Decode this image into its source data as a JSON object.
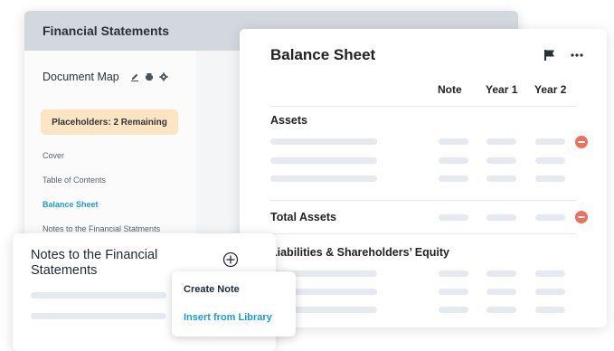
{
  "financial_statements": {
    "title": "Financial Statements",
    "document_map": {
      "label": "Document Map",
      "icons": [
        "pencil-icon",
        "printer-icon",
        "gear-icon"
      ],
      "placeholders_label": "Placeholders: 2 Remaining",
      "nav": [
        {
          "label": "Cover",
          "active": false
        },
        {
          "label": "Table of Contents",
          "active": false
        },
        {
          "label": "Balance Sheet",
          "active": true
        },
        {
          "label": "Notes to the Financial Statments",
          "active": false
        }
      ]
    }
  },
  "balance_sheet": {
    "title": "Balance Sheet",
    "icons": [
      "flag-icon",
      "more-icon"
    ],
    "columns": [
      "Note",
      "Year 1",
      "Year 2"
    ],
    "sections": {
      "assets": "Assets",
      "total_assets": "Total Assets",
      "liabilities": "Liabilities & Shareholders’ Equity"
    }
  },
  "notes_card": {
    "title": "Notes to the Financial Statements",
    "icon": "plus-circle-icon"
  },
  "popup_menu": {
    "items": [
      "Create Note",
      "Insert from Library"
    ]
  },
  "colors": {
    "accent": "#1a9bd7",
    "remove": "#ef6f5e",
    "placeholder_badge": "#fde4c3",
    "header": "#d3d8de"
  }
}
